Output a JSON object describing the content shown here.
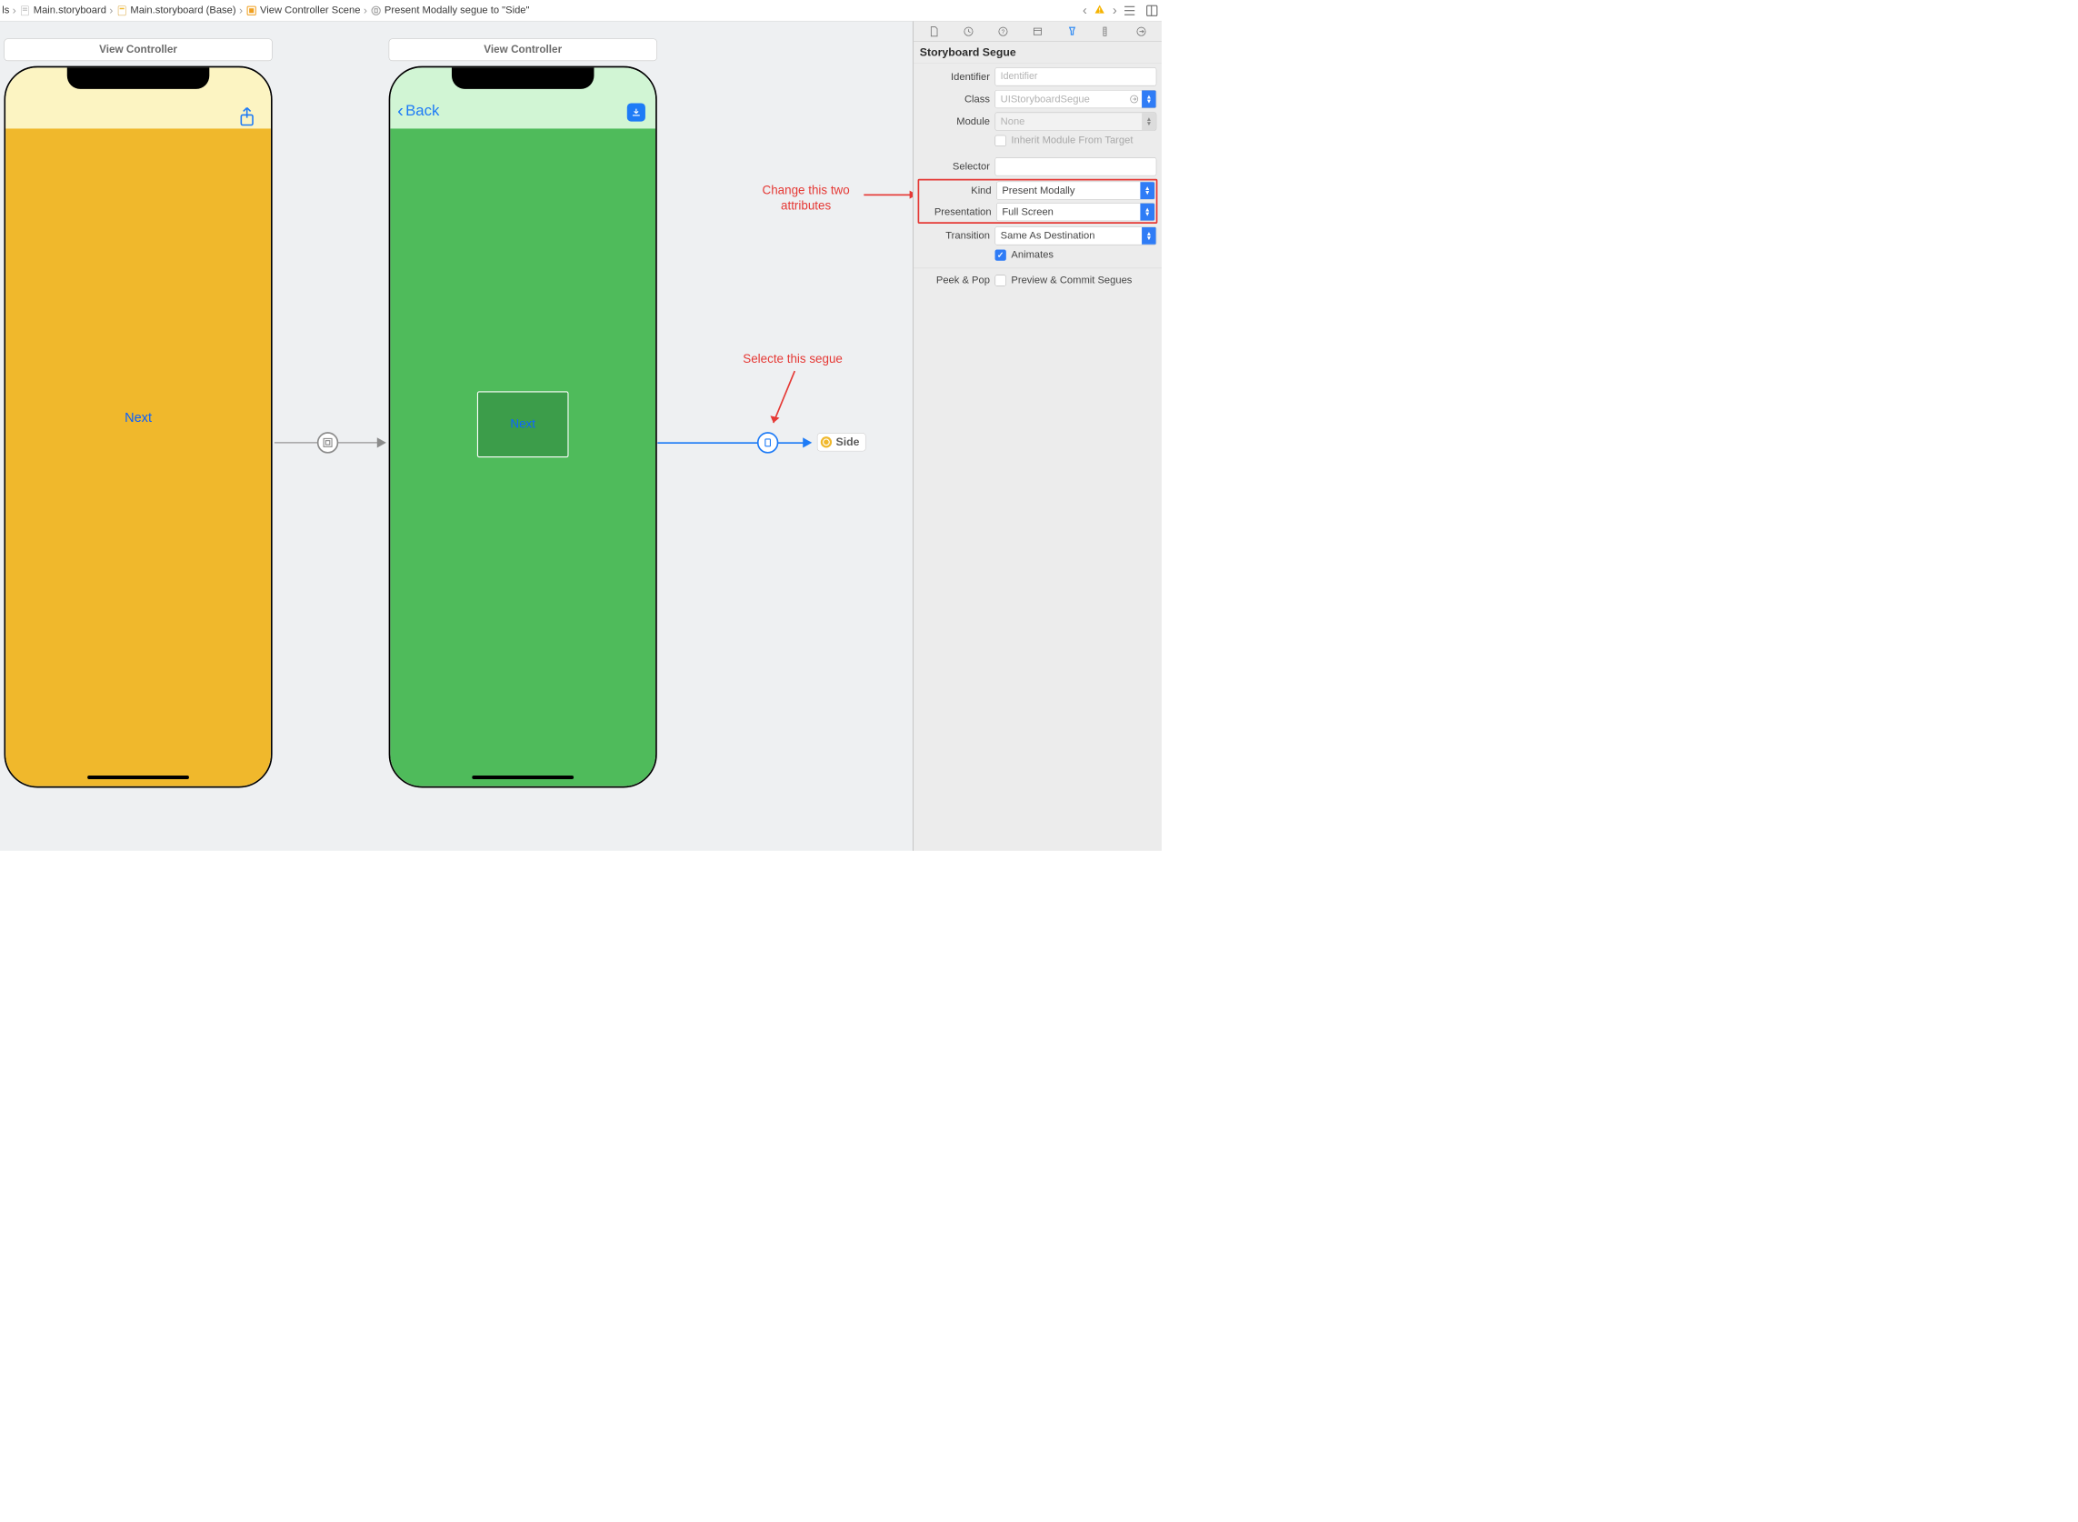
{
  "breadcrumb": {
    "items": [
      "ls",
      "Main.storyboard",
      "Main.storyboard (Base)",
      "View Controller Scene",
      "Present Modally segue to \"Side\""
    ]
  },
  "scenes": {
    "vc1": {
      "title": "View Controller",
      "button": "Next"
    },
    "vc2": {
      "title": "View Controller",
      "back": "Back",
      "button": "Next"
    },
    "side_chip": "Side"
  },
  "annotations": {
    "a1_line1": "Change this two",
    "a1_line2": "attributes",
    "a2": "Selecte this segue"
  },
  "inspector": {
    "section_title": "Storyboard Segue",
    "labels": {
      "identifier": "Identifier",
      "class": "Class",
      "module": "Module",
      "inherit": "Inherit Module From Target",
      "selector": "Selector",
      "kind": "Kind",
      "presentation": "Presentation",
      "transition": "Transition",
      "animates": "Animates",
      "peek": "Peek & Pop",
      "peek_label": "Preview & Commit Segues"
    },
    "placeholders": {
      "identifier": "Identifier"
    },
    "values": {
      "identifier": "",
      "class": "UIStoryboardSegue",
      "module": "None",
      "inherit_checked": false,
      "selector": "",
      "kind": "Present Modally",
      "presentation": "Full Screen",
      "transition": "Same As Destination",
      "animates_checked": true,
      "peek_checked": false
    }
  }
}
